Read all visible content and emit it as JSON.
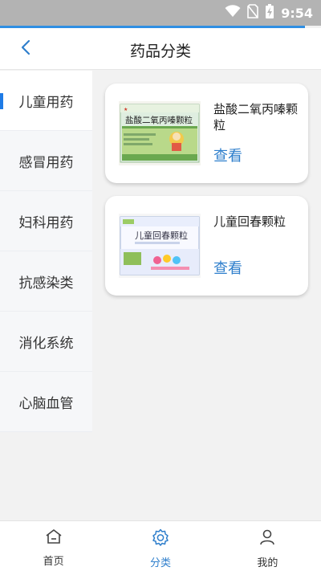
{
  "status_bar": {
    "time": "9:54",
    "icons": [
      "wifi-icon",
      "no-sim-icon",
      "battery-charging-icon"
    ]
  },
  "header": {
    "title": "药品分类",
    "back_icon": "chevron-left-icon"
  },
  "sidebar": {
    "active_index": 0,
    "items": [
      {
        "label": "儿童用药"
      },
      {
        "label": "感冒用药"
      },
      {
        "label": "妇科用药"
      },
      {
        "label": "抗感染类"
      },
      {
        "label": "消化系统"
      },
      {
        "label": "心脑血管"
      }
    ]
  },
  "products": [
    {
      "name": "盐酸二氧丙嗪颗粒",
      "view_label": "查看",
      "box_text": "盐酸二氧丙嗪颗粒"
    },
    {
      "name": "儿童回春颗粒",
      "view_label": "查看",
      "box_text": "儿童回春颗粒"
    }
  ],
  "tabbar": {
    "active": "category",
    "items": [
      {
        "id": "home",
        "label": "首页",
        "icon": "home-icon"
      },
      {
        "id": "category",
        "label": "分类",
        "icon": "gear-icon"
      },
      {
        "id": "mine",
        "label": "我的",
        "icon": "user-icon"
      }
    ]
  },
  "colors": {
    "accent": "#2f7fcc",
    "status_bar": "#b3b3b3",
    "sidebar_bg": "#f6f7f9",
    "page_bg": "#f2f2f2"
  }
}
